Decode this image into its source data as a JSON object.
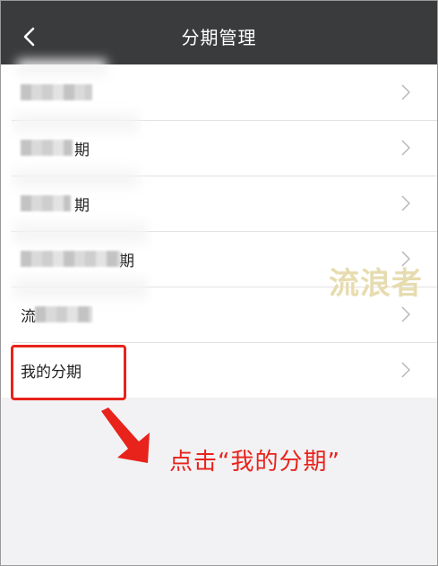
{
  "header": {
    "title": "分期管理"
  },
  "list": {
    "items": [
      {
        "label": ""
      },
      {
        "label": "期"
      },
      {
        "label": "期"
      },
      {
        "label": "期"
      },
      {
        "label": "流"
      },
      {
        "label": "我的分期"
      }
    ]
  },
  "annotation": {
    "text": "点击“我的分期”"
  },
  "watermark": {
    "text": "流浪者"
  },
  "colors": {
    "header_bg": "#3a3b3d",
    "annotation_red": "#e8231b"
  }
}
